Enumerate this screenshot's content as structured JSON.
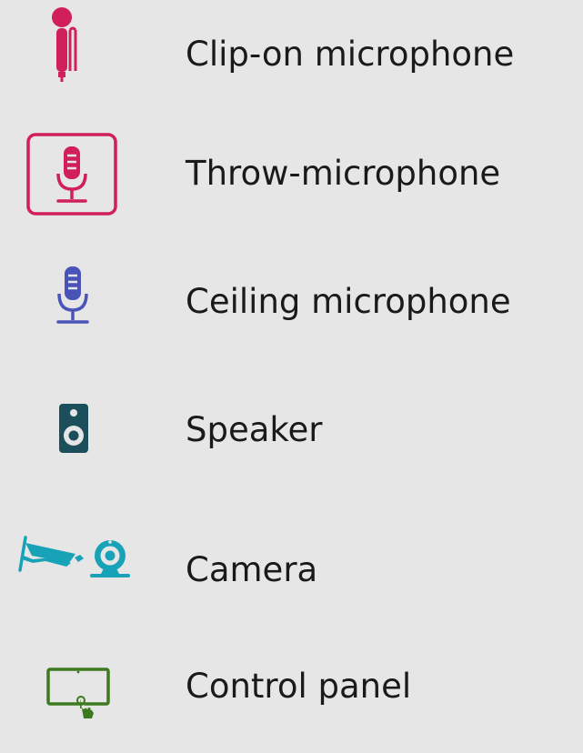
{
  "legend": {
    "items": [
      {
        "label": "Clip-on microphone",
        "icon": "clip-on-microphone-icon",
        "color": "#d11f5c"
      },
      {
        "label": "Throw-microphone",
        "icon": "throw-microphone-icon",
        "color": "#d11f5c"
      },
      {
        "label": "Ceiling microphone",
        "icon": "ceiling-microphone-icon",
        "color": "#4a54b8"
      },
      {
        "label": "Speaker",
        "icon": "speaker-icon",
        "color": "#1c4f5c"
      },
      {
        "label": "Camera",
        "icon": "camera-icon",
        "color": "#17a2b8"
      },
      {
        "label": "Control panel",
        "icon": "control-panel-icon",
        "color": "#3d7a1f"
      }
    ]
  }
}
